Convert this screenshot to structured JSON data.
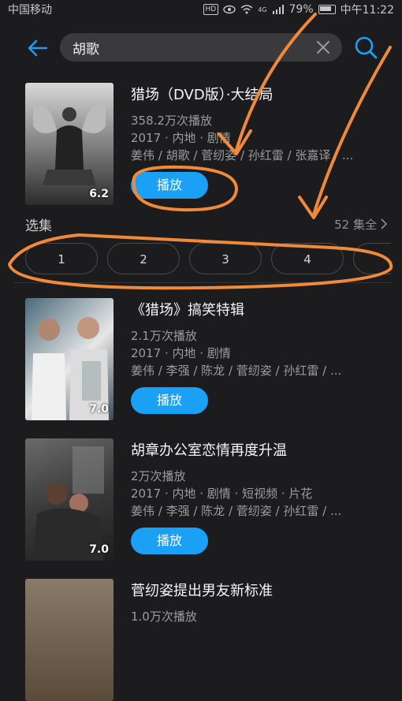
{
  "status_bar": {
    "carrier": "中国移动",
    "battery": "79%",
    "time": "中午11:22",
    "hd": "HD",
    "signal": "4G"
  },
  "search": {
    "query": "胡歌"
  },
  "results": [
    {
      "title": "猎场（DVD版）·大结局",
      "plays": "358.2万次播放",
      "meta": "2017 · 内地 · 剧情",
      "cast": "姜伟 / 胡歌 / 菅纫姿 / 孙红雷 / 张嘉译 / ...",
      "rating": "6.2",
      "play_label": "播放"
    },
    {
      "title": "《猎场》搞笑特辑",
      "plays": "2.1万次播放",
      "meta": "2017 · 内地 · 剧情",
      "cast": "姜伟 / 李强 / 陈龙 / 菅纫姿 / 孙红雷 / ...",
      "rating": "7.0",
      "play_label": "播放"
    },
    {
      "title": "胡章办公室恋情再度升温",
      "plays": "2万次播放",
      "meta": "2017 · 内地 · 剧情 · 短视频 · 片花",
      "cast": "姜伟 / 李强 / 陈龙 / 菅纫姿 / 孙红雷 / ...",
      "rating": "7.0",
      "play_label": "播放"
    },
    {
      "title": "菅纫姿提出男友新标准",
      "plays": "1.0万次播放"
    }
  ],
  "episodes": {
    "label": "选集",
    "total": "52 集全",
    "items": [
      "1",
      "2",
      "3",
      "4"
    ]
  },
  "colors": {
    "background": "#1c1c1e",
    "accent": "#1aa0f5",
    "annotation": "#f08a3a"
  }
}
